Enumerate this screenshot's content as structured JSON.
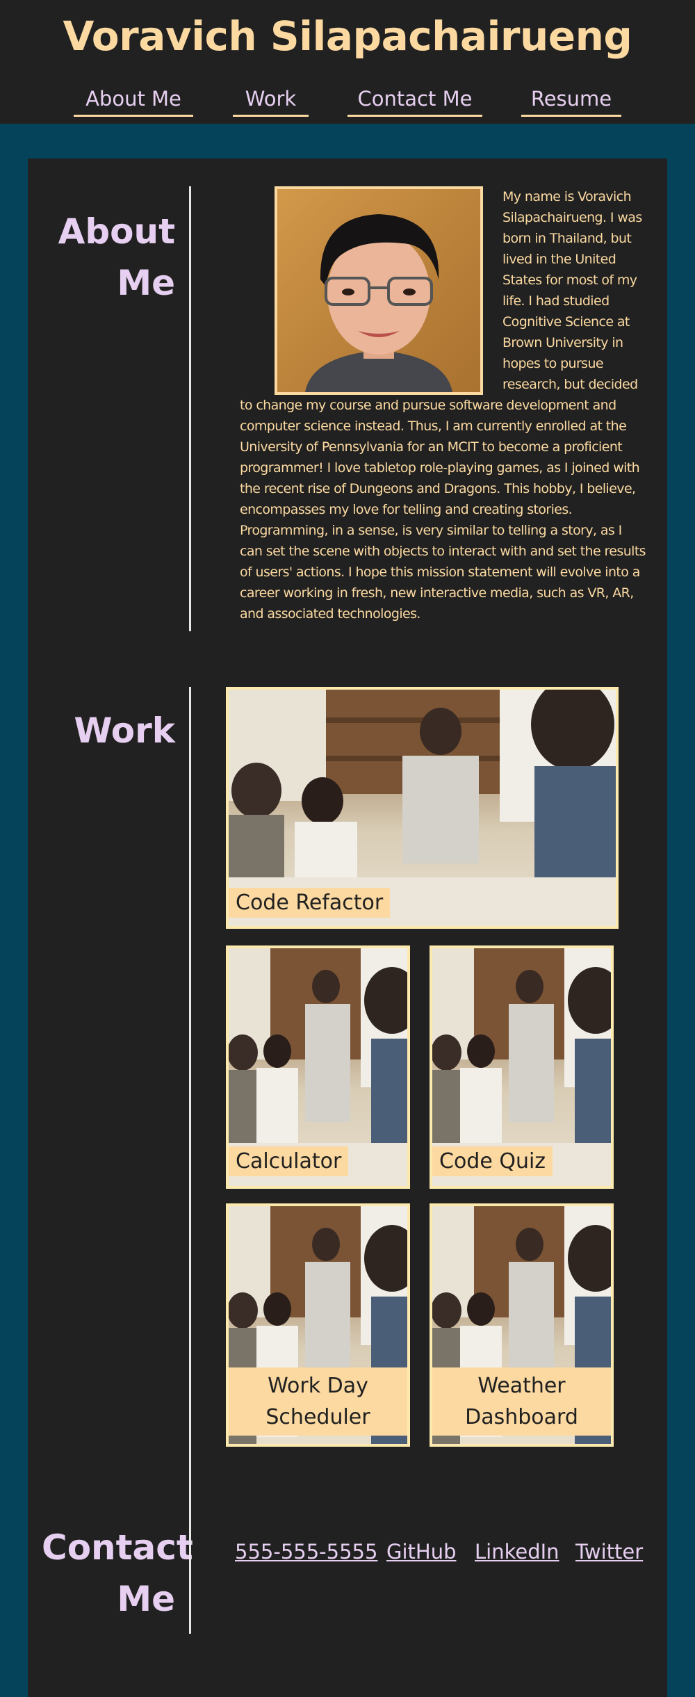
{
  "header": {
    "title": "Voravich Silapachairueng",
    "nav": [
      {
        "label": "About Me"
      },
      {
        "label": "Work"
      },
      {
        "label": "Contact Me"
      },
      {
        "label": "Resume"
      }
    ]
  },
  "about": {
    "heading": "About Me",
    "portrait_alt": "Portrait photo",
    "text": "My name is Voravich Silapachairueng. I was born in Thailand, but lived in the United States for most of my life. I had studied Cognitive Science at Brown University in hopes to pursue research, but decided to change my course and pursue software development and computer science instead. Thus, I am currently enrolled at the University of Pennsylvania for an MCIT to become a proficient programmer! I love tabletop role-playing games, as I joined with the recent rise of Dungeons and Dragons. This hobby, I believe, encompasses my love for telling and creating stories. Programming, in a sense, is very similar to telling a story, as I can set the scene with objects to interact with and set the results of users' actions. I hope this mission statement will evolve into a career working in fresh, new interactive media, such as VR, AR, and associated technologies."
  },
  "work": {
    "heading": "Work",
    "projects": [
      {
        "label": "Code Refactor"
      },
      {
        "label": "Calculator"
      },
      {
        "label": "Code Quiz"
      },
      {
        "label": "Work Day Scheduler"
      },
      {
        "label": "Weather Dashboard"
      }
    ]
  },
  "contact": {
    "heading": "Contact Me",
    "links": [
      {
        "label": "555-555-5555"
      },
      {
        "label": "GitHub"
      },
      {
        "label": "LinkedIn"
      },
      {
        "label": "Twitter"
      }
    ]
  },
  "colors": {
    "page_bg": "#04435a",
    "panel_bg": "#212121",
    "accent_peach": "#fbd9a1",
    "accent_lavender": "#e6cff0"
  }
}
